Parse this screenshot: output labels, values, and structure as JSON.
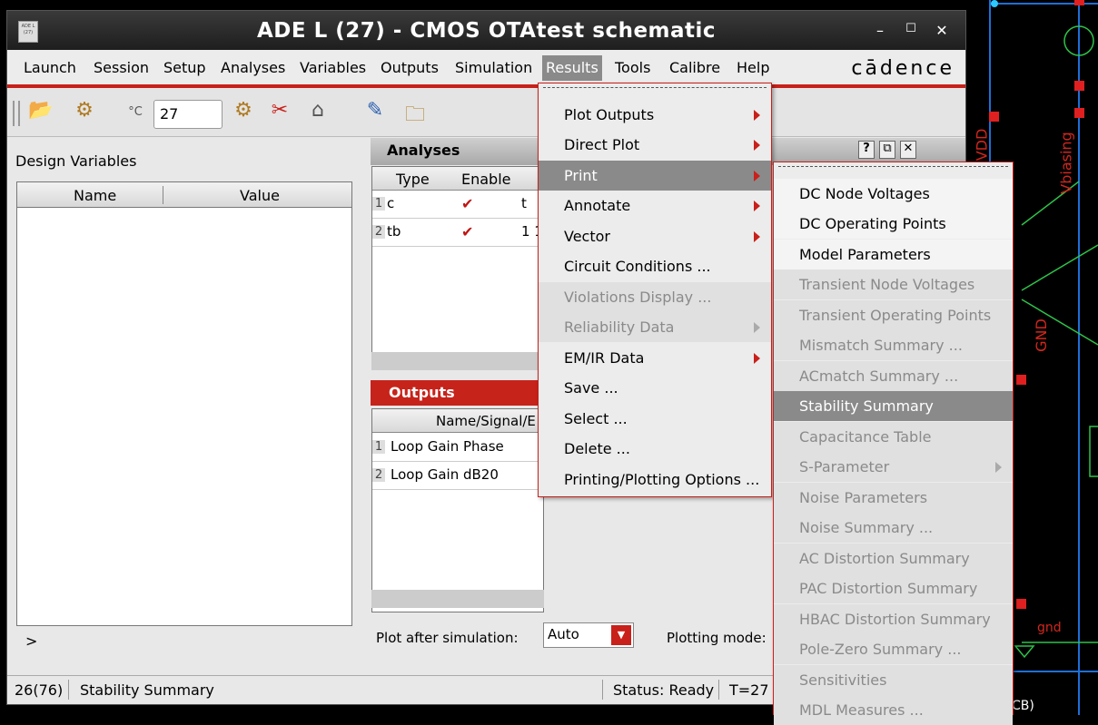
{
  "window": {
    "title": "ADE L (27) - CMOS OTAtest schematic",
    "logo": "cādence",
    "icon_text": "ADE L (27)"
  },
  "menubar": [
    "Launch",
    "Session",
    "Setup",
    "Analyses",
    "Variables",
    "Outputs",
    "Simulation",
    "Results",
    "Tools",
    "Calibre",
    "Help"
  ],
  "toolbar": {
    "temperature": "27",
    "temp_unit": "°C"
  },
  "design_variables": {
    "title": "Design Variables",
    "col_name": "Name",
    "col_value": "Value",
    "more": ">"
  },
  "analyses": {
    "title": "Analyses",
    "columns": [
      "Type",
      "Enable"
    ],
    "rows": [
      {
        "num": "1",
        "type": "c",
        "enabled": true,
        "extra": "t"
      },
      {
        "num": "2",
        "type": "tb",
        "enabled": true,
        "extra": "1 1"
      }
    ]
  },
  "outputs": {
    "title": "Outputs",
    "col": "Name/Signal/E",
    "rows": [
      {
        "num": "1",
        "name": "Loop Gain Phase"
      },
      {
        "num": "2",
        "name": "Loop Gain dB20"
      }
    ],
    "plot_after_label": "Plot after simulation:",
    "plot_after_value": "Auto",
    "plotting_mode_label": "Plotting mode:"
  },
  "status": {
    "history": "26(76)",
    "message": "Stability Summary",
    "state": "Status: Ready",
    "temp": "T=27"
  },
  "results_menu": [
    {
      "label": "Plot Outputs",
      "submenu": true
    },
    {
      "label": "Direct Plot",
      "submenu": true
    },
    {
      "label": "Print",
      "submenu": true,
      "highlighted": true
    },
    {
      "label": "Annotate",
      "submenu": true
    },
    {
      "label": "Vector",
      "submenu": true
    },
    {
      "label": "Circuit Conditions ..."
    },
    {
      "label": "Violations Display ...",
      "disabled": true
    },
    {
      "label": "Reliability Data",
      "submenu": true,
      "disabled": true
    },
    {
      "label": "EM/IR Data",
      "submenu": true
    },
    {
      "label": "Save ..."
    },
    {
      "label": "Select ..."
    },
    {
      "label": "Delete ..."
    },
    {
      "label": "Printing/Plotting Options ..."
    }
  ],
  "print_menu": [
    {
      "label": "DC Node Voltages"
    },
    {
      "label": "DC Operating Points"
    },
    {
      "label": "Model Parameters"
    },
    {
      "label": "Transient Node Voltages",
      "disabled": true
    },
    {
      "label": "Transient Operating Points",
      "disabled": true
    },
    {
      "label": "Mismatch Summary ...",
      "disabled": true
    },
    {
      "label": "ACmatch Summary ...",
      "disabled": true
    },
    {
      "label": "Stability Summary",
      "highlighted": true
    },
    {
      "label": "Capacitance Table",
      "disabled": true
    },
    {
      "label": "S-Parameter",
      "submenu": true,
      "disabled": true
    },
    {
      "label": "Noise Parameters",
      "disabled": true
    },
    {
      "label": "Noise Summary ...",
      "disabled": true
    },
    {
      "label": "AC Distortion Summary",
      "disabled": true
    },
    {
      "label": "PAC Distortion Summary",
      "disabled": true
    },
    {
      "label": "HBAC Distortion Summary",
      "disabled": true
    },
    {
      "label": "Pole-Zero Summary ...",
      "disabled": true
    },
    {
      "label": "Sensitivities",
      "disabled": true
    },
    {
      "label": "MDL Measures ...",
      "disabled": true
    }
  ],
  "schematic": {
    "labels": [
      "VDD",
      "Vbiasing",
      "GND",
      "gnd"
    ],
    "bottom_text": "CB)"
  },
  "colors": {
    "accent": "#c8201a",
    "highlight": "#8a8a8a",
    "schematic_wire": "#1e6fd6",
    "schematic_text": "#d4261c"
  }
}
